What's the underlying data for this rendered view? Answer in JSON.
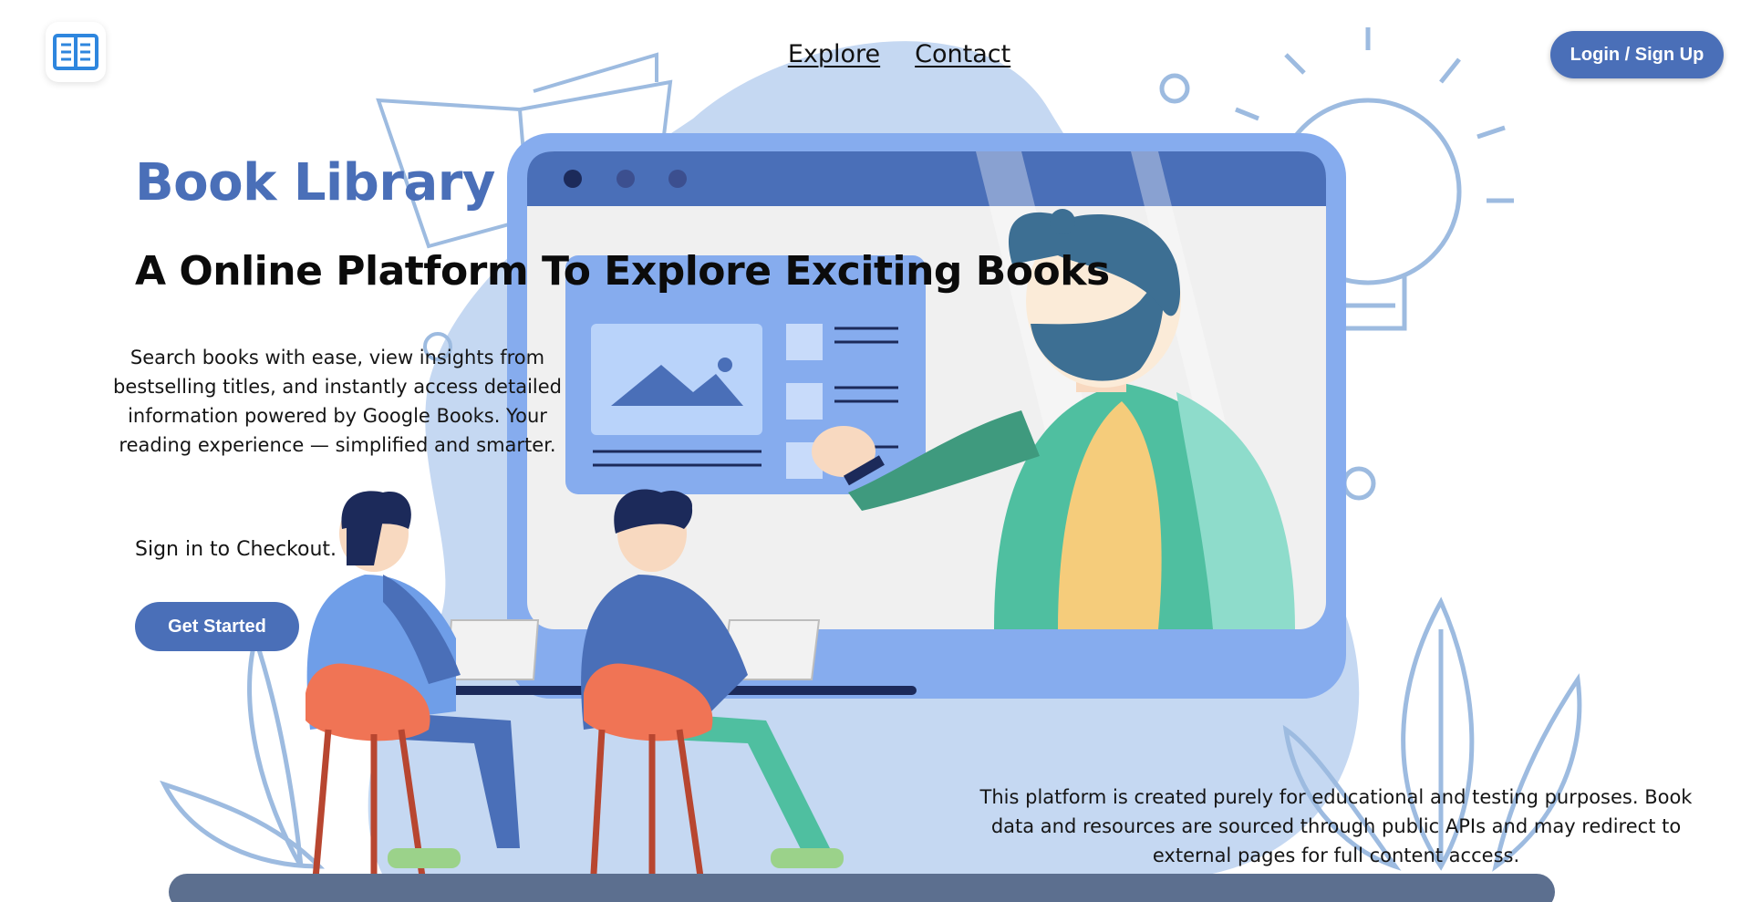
{
  "header": {
    "logo_icon": "book-open-icon",
    "nav": [
      {
        "label": "Explore"
      },
      {
        "label": "Contact"
      }
    ],
    "login_label": "Login / Sign Up"
  },
  "hero": {
    "brand": "Book Library",
    "headline": "A Online Platform To Explore Exciting Books",
    "description": "Search books with ease, view insights from bestselling titles, and instantly access detailed information powered by Google Books. Your reading experience — simplified and smarter.",
    "signin_note": "Sign in to Checkout.",
    "cta_label": "Get Started"
  },
  "footer_note": "This platform is created purely for educational and testing purposes. Book data and resources are sourced through public APIs and may redirect to external pages for full content access.",
  "colors": {
    "accent": "#4a6fb8",
    "blob": "#c5d8f2",
    "screen_frame": "#86acee",
    "line_art": "#9dbbe0"
  }
}
